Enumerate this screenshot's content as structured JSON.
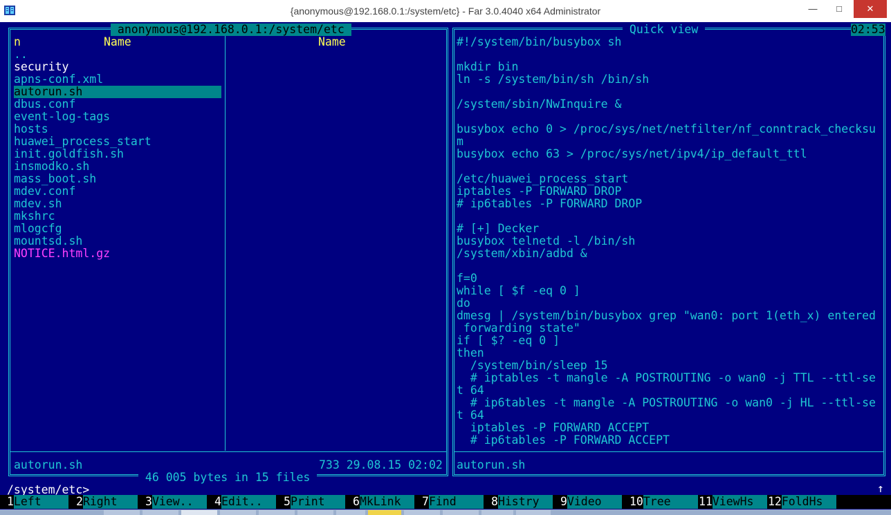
{
  "window": {
    "title": "{anonymous@192.168.0.1:/system/etc} - Far 3.0.4040 x64 Administrator",
    "min_glyph": "—",
    "max_glyph": "□",
    "close_glyph": "✕"
  },
  "left_panel": {
    "path_title": " anonymous@192.168.0.1:/system/etc ",
    "col_n_header": "n",
    "col1_header": "Name",
    "col2_header": "Name",
    "files": [
      {
        "name": "..",
        "style": "cyan"
      },
      {
        "name": "security",
        "style": "white"
      },
      {
        "name": "apns-conf.xml",
        "style": "cyan"
      },
      {
        "name": "autorun.sh",
        "style": "selected"
      },
      {
        "name": "dbus.conf",
        "style": "cyan"
      },
      {
        "name": "event-log-tags",
        "style": "cyan"
      },
      {
        "name": "hosts",
        "style": "cyan"
      },
      {
        "name": "huawei_process_start",
        "style": "cyan"
      },
      {
        "name": "init.goldfish.sh",
        "style": "cyan"
      },
      {
        "name": "insmodko.sh",
        "style": "cyan"
      },
      {
        "name": "mass_boot.sh",
        "style": "cyan"
      },
      {
        "name": "mdev.conf",
        "style": "cyan"
      },
      {
        "name": "mdev.sh",
        "style": "cyan"
      },
      {
        "name": "mkshrc",
        "style": "cyan"
      },
      {
        "name": "mlogcfg",
        "style": "cyan"
      },
      {
        "name": "mountsd.sh",
        "style": "cyan"
      },
      {
        "name": "NOTICE.html.gz",
        "style": "magenta"
      }
    ],
    "status_name": "autorun.sh",
    "status_info": "733 29.08.15 02:02",
    "summary": " 46 005 bytes in 15 files "
  },
  "right_panel": {
    "title": " Quick view ",
    "clock": "02:53",
    "status_name": "autorun.sh",
    "lines": [
      "#!/system/bin/busybox sh",
      "",
      "mkdir bin",
      "ln -s /system/bin/sh /bin/sh",
      "",
      "/system/sbin/NwInquire &",
      "",
      "busybox echo 0 > /proc/sys/net/netfilter/nf_conntrack_checksu",
      "m",
      "busybox echo 63 > /proc/sys/net/ipv4/ip_default_ttl",
      "",
      "/etc/huawei_process_start",
      "iptables -P FORWARD DROP",
      "# ip6tables -P FORWARD DROP",
      "",
      "# [+] Decker",
      "busybox telnetd -l /bin/sh",
      "/system/xbin/adbd &",
      "",
      "f=0",
      "while [ $f -eq 0 ]",
      "do",
      "dmesg | /system/bin/busybox grep \"wan0: port 1(eth_x) entered",
      " forwarding state\"",
      "if [ $? -eq 0 ]",
      "then",
      "  /system/bin/sleep 15",
      "  # iptables -t mangle -A POSTROUTING -o wan0 -j TTL --ttl-se",
      "t 64",
      "  # ip6tables -t mangle -A POSTROUTING -o wan0 -j HL --ttl-se",
      "t 64",
      "  iptables -P FORWARD ACCEPT",
      "  # ip6tables -P FORWARD ACCEPT"
    ]
  },
  "command_line": {
    "prompt": "/system/etc>",
    "scroll_marker": "↑"
  },
  "keybar": [
    {
      "num": "1",
      "label": "Left    "
    },
    {
      "num": "2",
      "label": "Right   "
    },
    {
      "num": "3",
      "label": "View..  "
    },
    {
      "num": "4",
      "label": "Edit..  "
    },
    {
      "num": "5",
      "label": "Print   "
    },
    {
      "num": "6",
      "label": "MkLink  "
    },
    {
      "num": "7",
      "label": "Find    "
    },
    {
      "num": "8",
      "label": "Histry  "
    },
    {
      "num": "9",
      "label": "Video   "
    },
    {
      "num": "10",
      "label": "Tree    "
    },
    {
      "num": "11",
      "label": "ViewHs  "
    },
    {
      "num": "12",
      "label": "FoldHs  "
    }
  ],
  "colors": {
    "background": "#000080",
    "frame": "#1fc7d3",
    "text": "#1fc7d3",
    "header": "#ffff55",
    "selection": "#00868b",
    "executable_highlight": "#ff40ff"
  }
}
